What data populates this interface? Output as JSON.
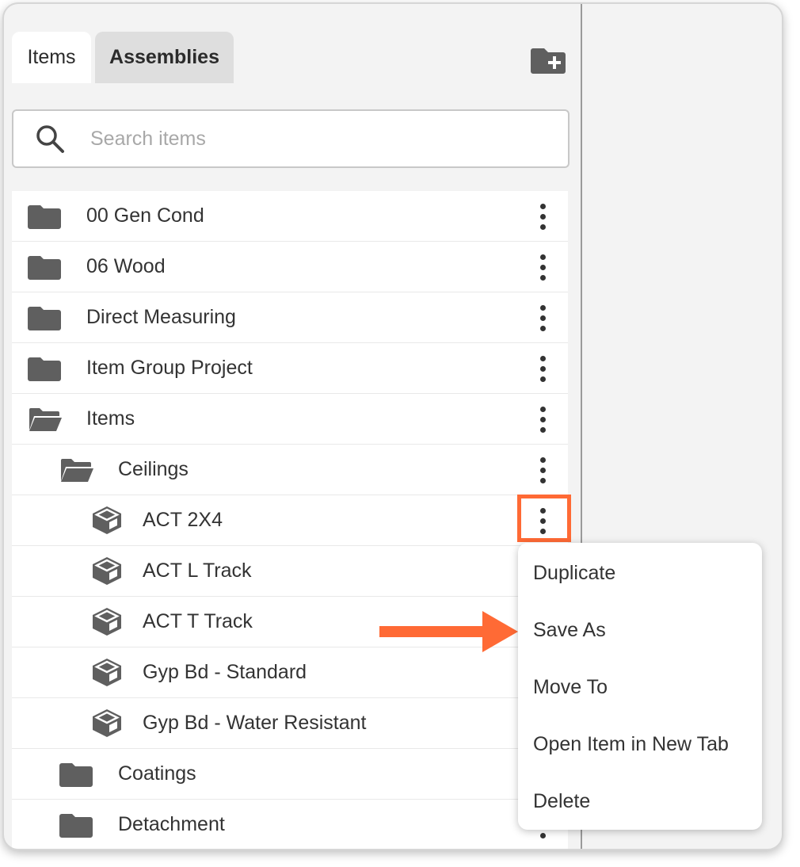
{
  "tabs": [
    {
      "label": "Items",
      "active": true
    },
    {
      "label": "Assemblies",
      "active": false
    }
  ],
  "search": {
    "placeholder": "Search items",
    "value": ""
  },
  "tree": [
    {
      "label": "00 Gen Cond",
      "type": "folder",
      "expanded": false,
      "level": 0
    },
    {
      "label": "06 Wood",
      "type": "folder",
      "expanded": false,
      "level": 0
    },
    {
      "label": "Direct Measuring",
      "type": "folder",
      "expanded": false,
      "level": 0
    },
    {
      "label": "Item Group Project",
      "type": "folder",
      "expanded": false,
      "level": 0
    },
    {
      "label": "Items",
      "type": "folder",
      "expanded": true,
      "level": 0
    },
    {
      "label": "Ceilings",
      "type": "folder",
      "expanded": true,
      "level": 1
    },
    {
      "label": "ACT 2X4",
      "type": "item",
      "level": 2
    },
    {
      "label": "ACT L Track",
      "type": "item",
      "level": 2
    },
    {
      "label": "ACT T Track",
      "type": "item",
      "level": 2
    },
    {
      "label": "Gyp Bd - Standard",
      "type": "item",
      "level": 2
    },
    {
      "label": "Gyp Bd - Water Resistant",
      "type": "item",
      "level": 2
    },
    {
      "label": "Coatings",
      "type": "folder",
      "expanded": false,
      "level": 1
    },
    {
      "label": "Detachment",
      "type": "folder",
      "expanded": false,
      "level": 1
    }
  ],
  "context_menu": {
    "items": [
      {
        "label": "Duplicate"
      },
      {
        "label": "Save As"
      },
      {
        "label": "Move To"
      },
      {
        "label": "Open Item in New Tab"
      },
      {
        "label": "Delete"
      }
    ]
  },
  "colors": {
    "accent": "#ff6a35",
    "icon": "#5f5f5f",
    "panel_bg": "#f3f3f3",
    "text": "#333333"
  },
  "icons": {
    "folder": "folder-icon",
    "open_folder": "folder-open-icon",
    "item": "cube-icon",
    "new_folder": "folder-plus-icon",
    "search": "search-icon",
    "more": "more-vertical-icon"
  }
}
